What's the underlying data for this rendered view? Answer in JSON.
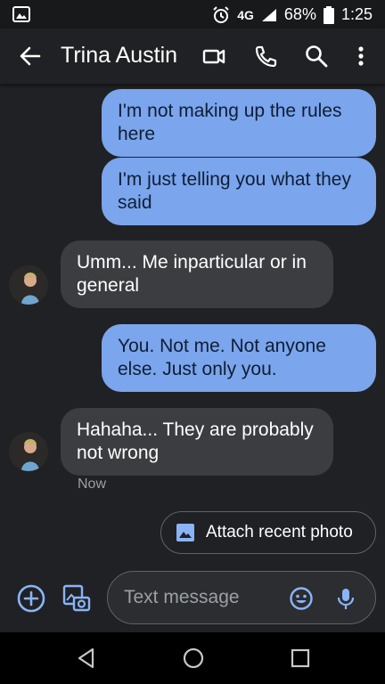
{
  "status_bar": {
    "network": "4G",
    "battery": "68%",
    "time": "1:25"
  },
  "header": {
    "contact_name": "Trina Austin"
  },
  "messages": [
    {
      "direction": "sent",
      "text": "I'm not making up the rules here"
    },
    {
      "direction": "sent",
      "text": "I'm just telling you what they said"
    },
    {
      "direction": "received",
      "text": "Umm... Me inparticular or in general"
    },
    {
      "direction": "sent",
      "text": "You. Not me. Not anyone else. Just only you."
    },
    {
      "direction": "received",
      "text": "Hahaha... They are probably not wrong"
    }
  ],
  "last_timestamp": "Now",
  "suggestion": {
    "label": "Attach recent photo"
  },
  "compose": {
    "placeholder": "Text message"
  },
  "colors": {
    "sent_bubble": "#7ba5ec",
    "received_bubble": "#3c3d40",
    "accent": "#8ab4f8",
    "background": "#202124"
  },
  "icons": [
    "image-icon",
    "alarm-icon",
    "signal-icon",
    "battery-icon",
    "back-arrow-icon",
    "video-call-icon",
    "phone-icon",
    "search-icon",
    "more-vert-icon",
    "add-icon",
    "gallery-icon",
    "emoji-icon",
    "mic-icon",
    "nav-back-icon",
    "nav-home-icon",
    "nav-recents-icon"
  ]
}
